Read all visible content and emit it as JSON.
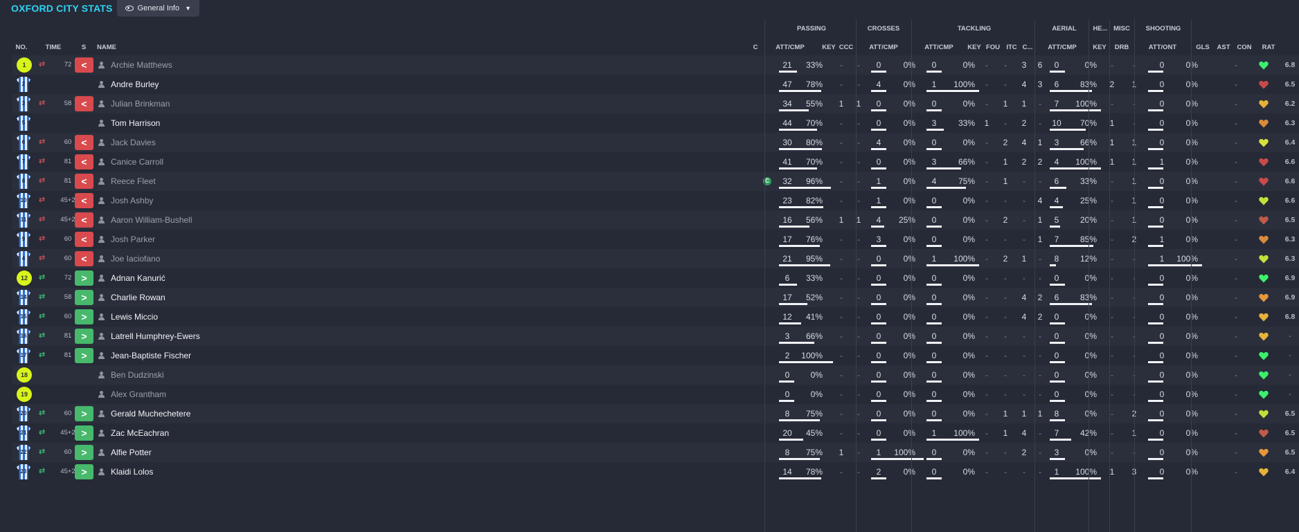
{
  "header": {
    "title": "OXFORD CITY STATS",
    "view_label": "General Info"
  },
  "groups": {
    "passing": "PASSING",
    "crosses": "CROSSES",
    "tackling": "TACKLING",
    "aerial": "AERIAL",
    "headers": "HE...",
    "misc": "MISC",
    "shooting": "SHOOTING"
  },
  "columns": {
    "no": "NO.",
    "time": "TIME",
    "s": "S",
    "name": "NAME",
    "c": "C",
    "pass_attcmp": "ATT/CMP",
    "pass_key": "KEY",
    "pass_ccc": "CCC",
    "cross_attcmp": "ATT/CMP",
    "tack_attcmp": "ATT/CMP",
    "tack_key": "KEY",
    "tack_fou": "FOU",
    "tack_itc": "ITC",
    "tack_c": "C...",
    "aer_attcmp": "ATT/CMP",
    "he_key": "KEY",
    "misc_drb": "DRB",
    "shoot_attont": "ATT/ONT",
    "gls": "GLS",
    "ast": "AST",
    "con": "CON",
    "rat": "RAT"
  },
  "colors": {
    "accent": "#2fd3f5",
    "sub_out": "#d84a4d",
    "sub_in": "#47b86c",
    "row_alt": "#2b2f3c",
    "background": "#262a36"
  },
  "icons": {
    "view": "eye-icon",
    "dropdown": "chevron-down-icon",
    "kit": "shirt-icon",
    "goalkeeper": "gk-shirt-icon",
    "sub_on": "sub-on-arrows-icon",
    "sub_off": "sub-off-arrows-icon",
    "person": "person-icon",
    "captain": "captain-badge-icon",
    "condition": "heart-icon"
  },
  "players": [
    {
      "no": "1",
      "gk": true,
      "sub": "out",
      "time": "72",
      "name": "Archie Matthews",
      "dim": true,
      "cap": false,
      "pass": [
        "21",
        "33%"
      ],
      "pfill": 0.33,
      "pkey": "-",
      "pccc": "-",
      "cross": [
        "0",
        "0%"
      ],
      "cfill": 0,
      "tack": [
        "0",
        "0%"
      ],
      "tfill": 0,
      "tkey": "-",
      "tfou": "-",
      "titc": "3",
      "tc": "6",
      "aer": [
        "0",
        "0%"
      ],
      "afill": 0,
      "hkey": "-",
      "drb": "-",
      "shoot": [
        "0",
        "0%"
      ],
      "sfill": 0,
      "gls": "",
      "ast": "-",
      "con": "#3cf06c",
      "rat": "6.8"
    },
    {
      "no": "2",
      "gk": false,
      "sub": "",
      "time": "",
      "name": "Andre Burley",
      "dim": false,
      "cap": false,
      "pass": [
        "47",
        "78%"
      ],
      "pfill": 0.78,
      "pkey": "-",
      "pccc": "-",
      "cross": [
        "4",
        "0%"
      ],
      "cfill": 0,
      "tack": [
        "1",
        "100%"
      ],
      "tfill": 1,
      "tkey": "-",
      "tfou": "-",
      "titc": "4",
      "tc": "3",
      "aer": [
        "6",
        "83%"
      ],
      "afill": 0.83,
      "hkey": "2",
      "drb": "1",
      "shoot": [
        "0",
        "0%"
      ],
      "sfill": 0,
      "gls": "",
      "ast": "-",
      "con": "#c84a4a",
      "rat": "6.5"
    },
    {
      "no": "3",
      "gk": false,
      "sub": "out",
      "time": "58",
      "name": "Julian Brinkman",
      "dim": true,
      "cap": false,
      "pass": [
        "34",
        "55%"
      ],
      "pfill": 0.55,
      "pkey": "1",
      "pccc": "1",
      "cross": [
        "0",
        "0%"
      ],
      "cfill": 0,
      "tack": [
        "0",
        "0%"
      ],
      "tfill": 0,
      "tkey": "-",
      "tfou": "1",
      "titc": "1",
      "tc": "-",
      "aer": [
        "7",
        "100%"
      ],
      "afill": 1,
      "hkey": "-",
      "drb": "-",
      "shoot": [
        "0",
        "0%"
      ],
      "sfill": 0,
      "gls": "",
      "ast": "-",
      "con": "#e8b13a",
      "rat": "6.2"
    },
    {
      "no": "5",
      "gk": false,
      "sub": "",
      "time": "",
      "name": "Tom Harrison",
      "dim": false,
      "cap": false,
      "pass": [
        "44",
        "70%"
      ],
      "pfill": 0.7,
      "pkey": "-",
      "pccc": "-",
      "cross": [
        "0",
        "0%"
      ],
      "cfill": 0,
      "tack": [
        "3",
        "33%"
      ],
      "tfill": 0.33,
      "tkey": "1",
      "tfou": "-",
      "titc": "2",
      "tc": "-",
      "aer": [
        "10",
        "70%"
      ],
      "afill": 0.7,
      "hkey": "1",
      "drb": "-",
      "shoot": [
        "0",
        "0%"
      ],
      "sfill": 0,
      "gls": "",
      "ast": "-",
      "con": "#d98a3c",
      "rat": "6.3"
    },
    {
      "no": "6",
      "gk": false,
      "sub": "out",
      "time": "60",
      "name": "Jack Davies",
      "dim": true,
      "cap": false,
      "pass": [
        "30",
        "80%"
      ],
      "pfill": 0.8,
      "pkey": "-",
      "pccc": "-",
      "cross": [
        "4",
        "0%"
      ],
      "cfill": 0,
      "tack": [
        "0",
        "0%"
      ],
      "tfill": 0,
      "tkey": "-",
      "tfou": "2",
      "titc": "4",
      "tc": "1",
      "aer": [
        "3",
        "66%"
      ],
      "afill": 0.66,
      "hkey": "1",
      "drb": "1",
      "shoot": [
        "0",
        "0%"
      ],
      "sfill": 0,
      "gls": "",
      "ast": "-",
      "con": "#d9e23a",
      "rat": "6.4"
    },
    {
      "no": "7",
      "gk": false,
      "sub": "out",
      "time": "81",
      "name": "Canice Carroll",
      "dim": true,
      "cap": false,
      "pass": [
        "41",
        "70%"
      ],
      "pfill": 0.7,
      "pkey": "-",
      "pccc": "-",
      "cross": [
        "0",
        "0%"
      ],
      "cfill": 0,
      "tack": [
        "3",
        "66%"
      ],
      "tfill": 0.66,
      "tkey": "-",
      "tfou": "1",
      "titc": "2",
      "tc": "2",
      "aer": [
        "4",
        "100%"
      ],
      "afill": 1,
      "hkey": "1",
      "drb": "1",
      "shoot": [
        "1",
        "0%"
      ],
      "sfill": 0,
      "gls": "",
      "ast": "-",
      "con": "#c84a4a",
      "rat": "6.6"
    },
    {
      "no": "8",
      "gk": false,
      "sub": "out",
      "time": "81",
      "name": "Reece Fleet",
      "dim": true,
      "cap": true,
      "pass": [
        "32",
        "96%"
      ],
      "pfill": 0.96,
      "pkey": "-",
      "pccc": "-",
      "cross": [
        "1",
        "0%"
      ],
      "cfill": 0,
      "tack": [
        "4",
        "75%"
      ],
      "tfill": 0.75,
      "tkey": "-",
      "tfou": "1",
      "titc": "-",
      "tc": "-",
      "aer": [
        "6",
        "33%"
      ],
      "afill": 0.33,
      "hkey": "-",
      "drb": "1",
      "shoot": [
        "0",
        "0%"
      ],
      "sfill": 0,
      "gls": "",
      "ast": "-",
      "con": "#c84a4a",
      "rat": "6.6"
    },
    {
      "no": "10",
      "gk": false,
      "sub": "out",
      "time": "45+2",
      "name": "Josh Ashby",
      "dim": true,
      "cap": false,
      "pass": [
        "23",
        "82%"
      ],
      "pfill": 0.82,
      "pkey": "-",
      "pccc": "-",
      "cross": [
        "1",
        "0%"
      ],
      "cfill": 0,
      "tack": [
        "0",
        "0%"
      ],
      "tfill": 0,
      "tkey": "-",
      "tfou": "-",
      "titc": "-",
      "tc": "4",
      "aer": [
        "4",
        "25%"
      ],
      "afill": 0.25,
      "hkey": "-",
      "drb": "1",
      "shoot": [
        "0",
        "0%"
      ],
      "sfill": 0,
      "gls": "",
      "ast": "-",
      "con": "#c3e03a",
      "rat": "6.6"
    },
    {
      "no": "11",
      "gk": false,
      "sub": "out",
      "time": "45+2",
      "name": "Aaron William-Bushell",
      "dim": true,
      "cap": false,
      "pass": [
        "16",
        "56%"
      ],
      "pfill": 0.56,
      "pkey": "1",
      "pccc": "1",
      "cross": [
        "4",
        "25%"
      ],
      "cfill": 0.25,
      "tack": [
        "0",
        "0%"
      ],
      "tfill": 0,
      "tkey": "-",
      "tfou": "2",
      "titc": "-",
      "tc": "1",
      "aer": [
        "5",
        "20%"
      ],
      "afill": 0.2,
      "hkey": "-",
      "drb": "1",
      "shoot": [
        "0",
        "0%"
      ],
      "sfill": 0,
      "gls": "",
      "ast": "-",
      "con": "#c25a4a",
      "rat": "6.5"
    },
    {
      "no": "9",
      "gk": false,
      "sub": "out",
      "time": "60",
      "name": "Josh Parker",
      "dim": true,
      "cap": false,
      "pass": [
        "17",
        "76%"
      ],
      "pfill": 0.76,
      "pkey": "-",
      "pccc": "-",
      "cross": [
        "3",
        "0%"
      ],
      "cfill": 0,
      "tack": [
        "0",
        "0%"
      ],
      "tfill": 0,
      "tkey": "-",
      "tfou": "-",
      "titc": "-",
      "tc": "1",
      "aer": [
        "7",
        "85%"
      ],
      "afill": 0.85,
      "hkey": "-",
      "drb": "2",
      "shoot": [
        "1",
        "0%"
      ],
      "sfill": 0,
      "gls": "",
      "ast": "-",
      "con": "#d98a3c",
      "rat": "6.3"
    },
    {
      "no": "4",
      "gk": false,
      "sub": "out",
      "time": "60",
      "name": "Joe Iaciofano",
      "dim": true,
      "cap": false,
      "pass": [
        "21",
        "95%"
      ],
      "pfill": 0.95,
      "pkey": "-",
      "pccc": "-",
      "cross": [
        "0",
        "0%"
      ],
      "cfill": 0,
      "tack": [
        "1",
        "100%"
      ],
      "tfill": 1,
      "tkey": "-",
      "tfou": "2",
      "titc": "1",
      "tc": "-",
      "aer": [
        "8",
        "12%"
      ],
      "afill": 0.12,
      "hkey": "-",
      "drb": "-",
      "shoot": [
        "1",
        "100%"
      ],
      "sfill": 1,
      "gls": "",
      "ast": "-",
      "con": "#c3e03a",
      "rat": "6.3"
    },
    {
      "no": "12",
      "gk": true,
      "sub": "in",
      "time": "72",
      "name": "Adnan Kanurić",
      "dim": false,
      "cap": false,
      "pass": [
        "6",
        "33%"
      ],
      "pfill": 0.33,
      "pkey": "-",
      "pccc": "-",
      "cross": [
        "0",
        "0%"
      ],
      "cfill": 0,
      "tack": [
        "0",
        "0%"
      ],
      "tfill": 0,
      "tkey": "-",
      "tfou": "-",
      "titc": "-",
      "tc": "-",
      "aer": [
        "0",
        "0%"
      ],
      "afill": 0,
      "hkey": "-",
      "drb": "-",
      "shoot": [
        "0",
        "0%"
      ],
      "sfill": 0,
      "gls": "",
      "ast": "-",
      "con": "#3cf06c",
      "rat": "6.9"
    },
    {
      "no": "14",
      "gk": false,
      "sub": "in",
      "time": "58",
      "name": "Charlie Rowan",
      "dim": false,
      "cap": false,
      "pass": [
        "17",
        "52%"
      ],
      "pfill": 0.52,
      "pkey": "-",
      "pccc": "-",
      "cross": [
        "0",
        "0%"
      ],
      "cfill": 0,
      "tack": [
        "0",
        "0%"
      ],
      "tfill": 0,
      "tkey": "-",
      "tfou": "-",
      "titc": "4",
      "tc": "2",
      "aer": [
        "6",
        "83%"
      ],
      "afill": 0.83,
      "hkey": "-",
      "drb": "-",
      "shoot": [
        "0",
        "0%"
      ],
      "sfill": 0,
      "gls": "",
      "ast": "-",
      "con": "#e8963a",
      "rat": "6.9"
    },
    {
      "no": "15",
      "gk": false,
      "sub": "in",
      "time": "60",
      "name": "Lewis Miccio",
      "dim": false,
      "cap": false,
      "pass": [
        "12",
        "41%"
      ],
      "pfill": 0.41,
      "pkey": "-",
      "pccc": "-",
      "cross": [
        "0",
        "0%"
      ],
      "cfill": 0,
      "tack": [
        "0",
        "0%"
      ],
      "tfill": 0,
      "tkey": "-",
      "tfou": "-",
      "titc": "4",
      "tc": "2",
      "aer": [
        "0",
        "0%"
      ],
      "afill": 0,
      "hkey": "-",
      "drb": "-",
      "shoot": [
        "0",
        "0%"
      ],
      "sfill": 0,
      "gls": "",
      "ast": "-",
      "con": "#e8b13a",
      "rat": "6.8"
    },
    {
      "no": "16",
      "gk": false,
      "sub": "in",
      "time": "81",
      "name": "Latrell Humphrey-Ewers",
      "dim": false,
      "cap": false,
      "pass": [
        "3",
        "66%"
      ],
      "pfill": 0.66,
      "pkey": "-",
      "pccc": "-",
      "cross": [
        "0",
        "0%"
      ],
      "cfill": 0,
      "tack": [
        "0",
        "0%"
      ],
      "tfill": 0,
      "tkey": "-",
      "tfou": "-",
      "titc": "-",
      "tc": "-",
      "aer": [
        "0",
        "0%"
      ],
      "afill": 0,
      "hkey": "-",
      "drb": "-",
      "shoot": [
        "0",
        "0%"
      ],
      "sfill": 0,
      "gls": "",
      "ast": "-",
      "con": "#e8b13a",
      "rat": "-"
    },
    {
      "no": "17",
      "gk": false,
      "sub": "in",
      "time": "81",
      "name": "Jean-Baptiste Fischer",
      "dim": false,
      "cap": false,
      "pass": [
        "2",
        "100%"
      ],
      "pfill": 1,
      "pkey": "-",
      "pccc": "-",
      "cross": [
        "0",
        "0%"
      ],
      "cfill": 0,
      "tack": [
        "0",
        "0%"
      ],
      "tfill": 0,
      "tkey": "-",
      "tfou": "-",
      "titc": "-",
      "tc": "-",
      "aer": [
        "0",
        "0%"
      ],
      "afill": 0,
      "hkey": "-",
      "drb": "-",
      "shoot": [
        "0",
        "0%"
      ],
      "sfill": 0,
      "gls": "",
      "ast": "-",
      "con": "#3cf06c",
      "rat": "-"
    },
    {
      "no": "18",
      "gk": true,
      "sub": "",
      "time": "",
      "name": "Ben Dudzinski",
      "dim": true,
      "cap": false,
      "pass": [
        "0",
        "0%"
      ],
      "pfill": 0,
      "pkey": "-",
      "pccc": "-",
      "cross": [
        "0",
        "0%"
      ],
      "cfill": 0,
      "tack": [
        "0",
        "0%"
      ],
      "tfill": 0,
      "tkey": "-",
      "tfou": "-",
      "titc": "-",
      "tc": "-",
      "aer": [
        "0",
        "0%"
      ],
      "afill": 0,
      "hkey": "-",
      "drb": "-",
      "shoot": [
        "0",
        "0%"
      ],
      "sfill": 0,
      "gls": "",
      "ast": "-",
      "con": "#3cf06c",
      "rat": "-"
    },
    {
      "no": "19",
      "gk": true,
      "sub": "",
      "time": "",
      "name": "Alex Grantham",
      "dim": true,
      "cap": false,
      "pass": [
        "0",
        "0%"
      ],
      "pfill": 0,
      "pkey": "-",
      "pccc": "-",
      "cross": [
        "0",
        "0%"
      ],
      "cfill": 0,
      "tack": [
        "0",
        "0%"
      ],
      "tfill": 0,
      "tkey": "-",
      "tfou": "-",
      "titc": "-",
      "tc": "-",
      "aer": [
        "0",
        "0%"
      ],
      "afill": 0,
      "hkey": "-",
      "drb": "-",
      "shoot": [
        "0",
        "0%"
      ],
      "sfill": 0,
      "gls": "",
      "ast": "-",
      "con": "#3cf06c",
      "rat": "-"
    },
    {
      "no": "20",
      "gk": false,
      "sub": "in",
      "time": "60",
      "name": "Gerald Muchechetere",
      "dim": false,
      "cap": false,
      "pass": [
        "8",
        "75%"
      ],
      "pfill": 0.75,
      "pkey": "-",
      "pccc": "-",
      "cross": [
        "0",
        "0%"
      ],
      "cfill": 0,
      "tack": [
        "0",
        "0%"
      ],
      "tfill": 0,
      "tkey": "-",
      "tfou": "1",
      "titc": "1",
      "tc": "1",
      "aer": [
        "8",
        "0%"
      ],
      "afill": 0,
      "hkey": "-",
      "drb": "2",
      "shoot": [
        "0",
        "0%"
      ],
      "sfill": 0,
      "gls": "",
      "ast": "-",
      "con": "#c3e03a",
      "rat": "6.5"
    },
    {
      "no": "21",
      "gk": false,
      "sub": "in",
      "time": "45+2",
      "name": "Zac McEachran",
      "dim": false,
      "cap": false,
      "pass": [
        "20",
        "45%"
      ],
      "pfill": 0.45,
      "pkey": "-",
      "pccc": "-",
      "cross": [
        "0",
        "0%"
      ],
      "cfill": 0,
      "tack": [
        "1",
        "100%"
      ],
      "tfill": 1,
      "tkey": "-",
      "tfou": "1",
      "titc": "4",
      "tc": "-",
      "aer": [
        "7",
        "42%"
      ],
      "afill": 0.42,
      "hkey": "-",
      "drb": "1",
      "shoot": [
        "0",
        "0%"
      ],
      "sfill": 0,
      "gls": "",
      "ast": "-",
      "con": "#c25a4a",
      "rat": "6.5"
    },
    {
      "no": "22",
      "gk": false,
      "sub": "in",
      "time": "60",
      "name": "Alfie Potter",
      "dim": false,
      "cap": false,
      "pass": [
        "8",
        "75%"
      ],
      "pfill": 0.75,
      "pkey": "1",
      "pccc": "-",
      "cross": [
        "1",
        "100%"
      ],
      "cfill": 1,
      "tack": [
        "0",
        "0%"
      ],
      "tfill": 0,
      "tkey": "-",
      "tfou": "-",
      "titc": "2",
      "tc": "-",
      "aer": [
        "3",
        "0%"
      ],
      "afill": 0,
      "hkey": "-",
      "drb": "-",
      "shoot": [
        "0",
        "0%"
      ],
      "sfill": 0,
      "gls": "",
      "ast": "-",
      "con": "#e8963a",
      "rat": "6.5"
    },
    {
      "no": "23",
      "gk": false,
      "sub": "in",
      "time": "45+2",
      "name": "Klaidi Lolos",
      "dim": false,
      "cap": false,
      "pass": [
        "14",
        "78%"
      ],
      "pfill": 0.78,
      "pkey": "-",
      "pccc": "-",
      "cross": [
        "2",
        "0%"
      ],
      "cfill": 0,
      "tack": [
        "0",
        "0%"
      ],
      "tfill": 0,
      "tkey": "-",
      "tfou": "-",
      "titc": "-",
      "tc": "-",
      "aer": [
        "1",
        "100%"
      ],
      "afill": 1,
      "hkey": "1",
      "drb": "3",
      "shoot": [
        "0",
        "0%"
      ],
      "sfill": 0,
      "gls": "",
      "ast": "-",
      "con": "#e8b13a",
      "rat": "6.4"
    }
  ]
}
